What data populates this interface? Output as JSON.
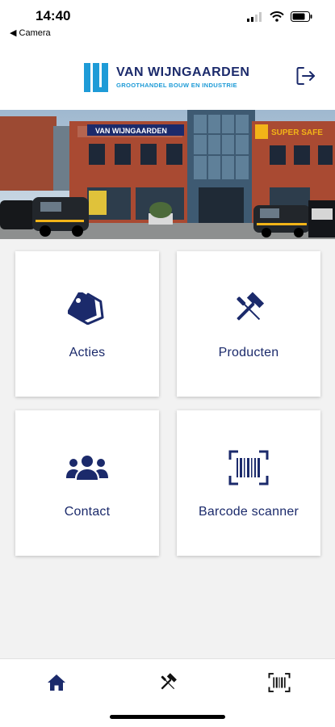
{
  "status_bar": {
    "time": "14:40",
    "back_app": "◀ Camera"
  },
  "header": {
    "logo_name": "VAN WIJNGAARDEN",
    "logo_tagline": "GROOTHANDEL BOUW EN INDUSTRIE",
    "logout_icon": "logout-icon"
  },
  "hero": {
    "sign_left": "VAN WIJNGAARDEN",
    "sign_right": "SUPER SAFE"
  },
  "tiles": [
    {
      "label": "Acties",
      "icon": "tags-icon"
    },
    {
      "label": "Producten",
      "icon": "tools-icon"
    },
    {
      "label": "Contact",
      "icon": "users-icon"
    },
    {
      "label": "Barcode scanner",
      "icon": "barcode-icon"
    }
  ],
  "bottom_nav": [
    {
      "icon": "home-icon",
      "active": true
    },
    {
      "icon": "tools-icon",
      "active": false
    },
    {
      "icon": "barcode-icon",
      "active": false
    }
  ],
  "colors": {
    "brand_navy": "#1b2a6b",
    "brand_blue": "#1e9bd7",
    "brick": "#a94a32",
    "sign_yellow": "#f2b418"
  }
}
